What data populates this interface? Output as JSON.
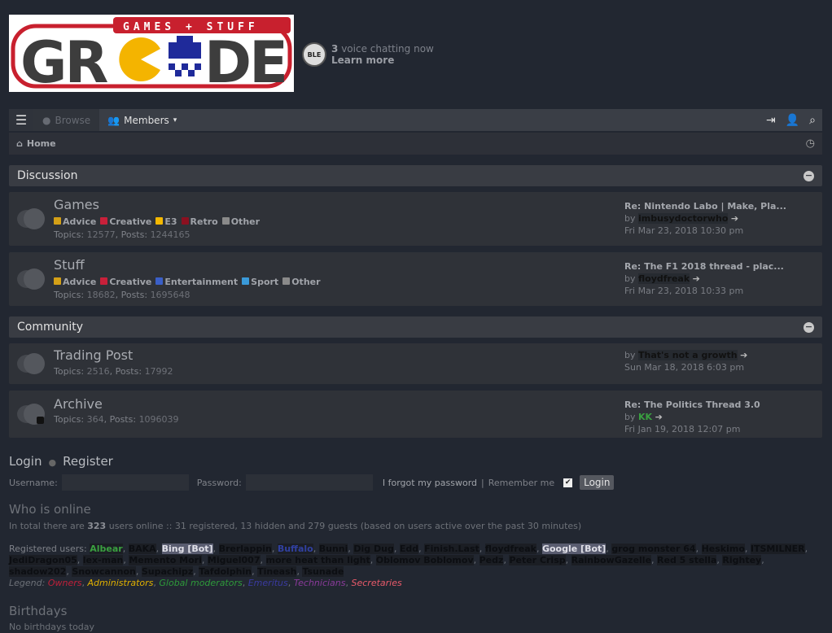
{
  "logo": {
    "tagline": "GAMES + STUFF",
    "name": "GRCADE"
  },
  "voice": {
    "icon_text": "BLE",
    "count": "3",
    "text": "voice chatting now",
    "link": "Learn more"
  },
  "nav": {
    "browse": "Browse",
    "members": "Members"
  },
  "breadcrumb": {
    "home": "Home"
  },
  "categories": [
    {
      "title": "Discussion",
      "forums": [
        {
          "name": "Games",
          "subs": [
            {
              "label": "Advice",
              "color": "#d4a017"
            },
            {
              "label": "Creative",
              "color": "#c8203a"
            },
            {
              "label": "E3",
              "color": "#f5b800"
            },
            {
              "label": "Retro",
              "color": "#8b1020"
            },
            {
              "label": "Other",
              "color": "#8a8a8a"
            }
          ],
          "topics": "12577",
          "posts": "1244165",
          "last_title": "Re: Nintendo Labo | Make, Pla...",
          "last_by": "imbusydoctorwho",
          "last_date": "Fri Mar 23, 2018 10:30 pm"
        },
        {
          "name": "Stuff",
          "subs": [
            {
              "label": "Advice",
              "color": "#d4a017"
            },
            {
              "label": "Creative",
              "color": "#c8203a"
            },
            {
              "label": "Entertainment",
              "color": "#3a5fc8"
            },
            {
              "label": "Sport",
              "color": "#3a9ad9"
            },
            {
              "label": "Other",
              "color": "#8a8a8a"
            }
          ],
          "topics": "18682",
          "posts": "1695648",
          "last_title": "Re: The F1 2018 thread - plac...",
          "last_by": "floydfreak",
          "last_date": "Fri Mar 23, 2018 10:33 pm"
        }
      ]
    },
    {
      "title": "Community",
      "forums": [
        {
          "name": "Trading Post",
          "subs": [],
          "topics": "2516",
          "posts": "17992",
          "last_title": "",
          "last_by": "That's not a growth",
          "last_date": "Sun Mar 18, 2018 6:03 pm"
        },
        {
          "name": "Archive",
          "subs": [],
          "topics": "364",
          "posts": "1096039",
          "last_title": "Re: The Politics Thread 3.0",
          "last_by": "KK",
          "last_date": "Fri Jan 19, 2018 12:07 pm"
        }
      ]
    }
  ],
  "labels": {
    "by": "by",
    "topics": "Topics:",
    "posts": "Posts:"
  },
  "login": {
    "login": "Login",
    "register": "Register",
    "username": "Username:",
    "password": "Password:",
    "forgot": "I forgot my password",
    "remember": "Remember me",
    "button": "Login"
  },
  "online": {
    "title": "Who is online",
    "prefix": "In total there are",
    "total": "323",
    "suffix": "users online :: 31 registered, 13 hidden and 279 guests (based on users active over the past 30 minutes)",
    "registered_label": "Registered users:",
    "users": [
      {
        "n": "Albear",
        "c": "#3aa040"
      },
      {
        "n": "BAKA"
      },
      {
        "n": "Bing [Bot]",
        "c": "#b8b8c8",
        "bot": true
      },
      {
        "n": "Brerlappin"
      },
      {
        "n": "Buffalo",
        "c": "#3040a0"
      },
      {
        "n": "Bunni"
      },
      {
        "n": "Dig Dug"
      },
      {
        "n": "Edd"
      },
      {
        "n": "Finish.Last"
      },
      {
        "n": "floydfreak"
      },
      {
        "n": "Google [Bot]",
        "c": "#b8b8c8",
        "bot": true
      },
      {
        "n": "grog monster 64"
      },
      {
        "n": "Heskimo"
      },
      {
        "n": "ITSMILNER"
      },
      {
        "n": "JediDragon05"
      },
      {
        "n": "lex-man"
      },
      {
        "n": "Memento Mori"
      },
      {
        "n": "Miguel007"
      },
      {
        "n": "more heat than light"
      },
      {
        "n": "Oblomov Boblomov"
      },
      {
        "n": "Pedz"
      },
      {
        "n": "Peter Crisp"
      },
      {
        "n": "RainbowGazelle"
      },
      {
        "n": "Red 5 stella"
      },
      {
        "n": "Rightey"
      },
      {
        "n": "shadow202"
      },
      {
        "n": "Snowcannon"
      },
      {
        "n": "Supachipz"
      },
      {
        "n": "Tafdolphin"
      },
      {
        "n": "Tineash"
      },
      {
        "n": "Tsunade"
      }
    ],
    "legend_label": "Legend:",
    "legend": [
      {
        "n": "Owners",
        "c": "#c0203a"
      },
      {
        "n": "Administrators",
        "c": "#e0b000"
      },
      {
        "n": "Global moderators",
        "c": "#2e9a3a"
      },
      {
        "n": "Emeritus",
        "c": "#3a3aa0"
      },
      {
        "n": "Technicians",
        "c": "#8a3a9a"
      },
      {
        "n": "Secretaries",
        "c": "#e85a6a"
      }
    ]
  },
  "birthdays": {
    "title": "Birthdays",
    "text": "No birthdays today"
  }
}
